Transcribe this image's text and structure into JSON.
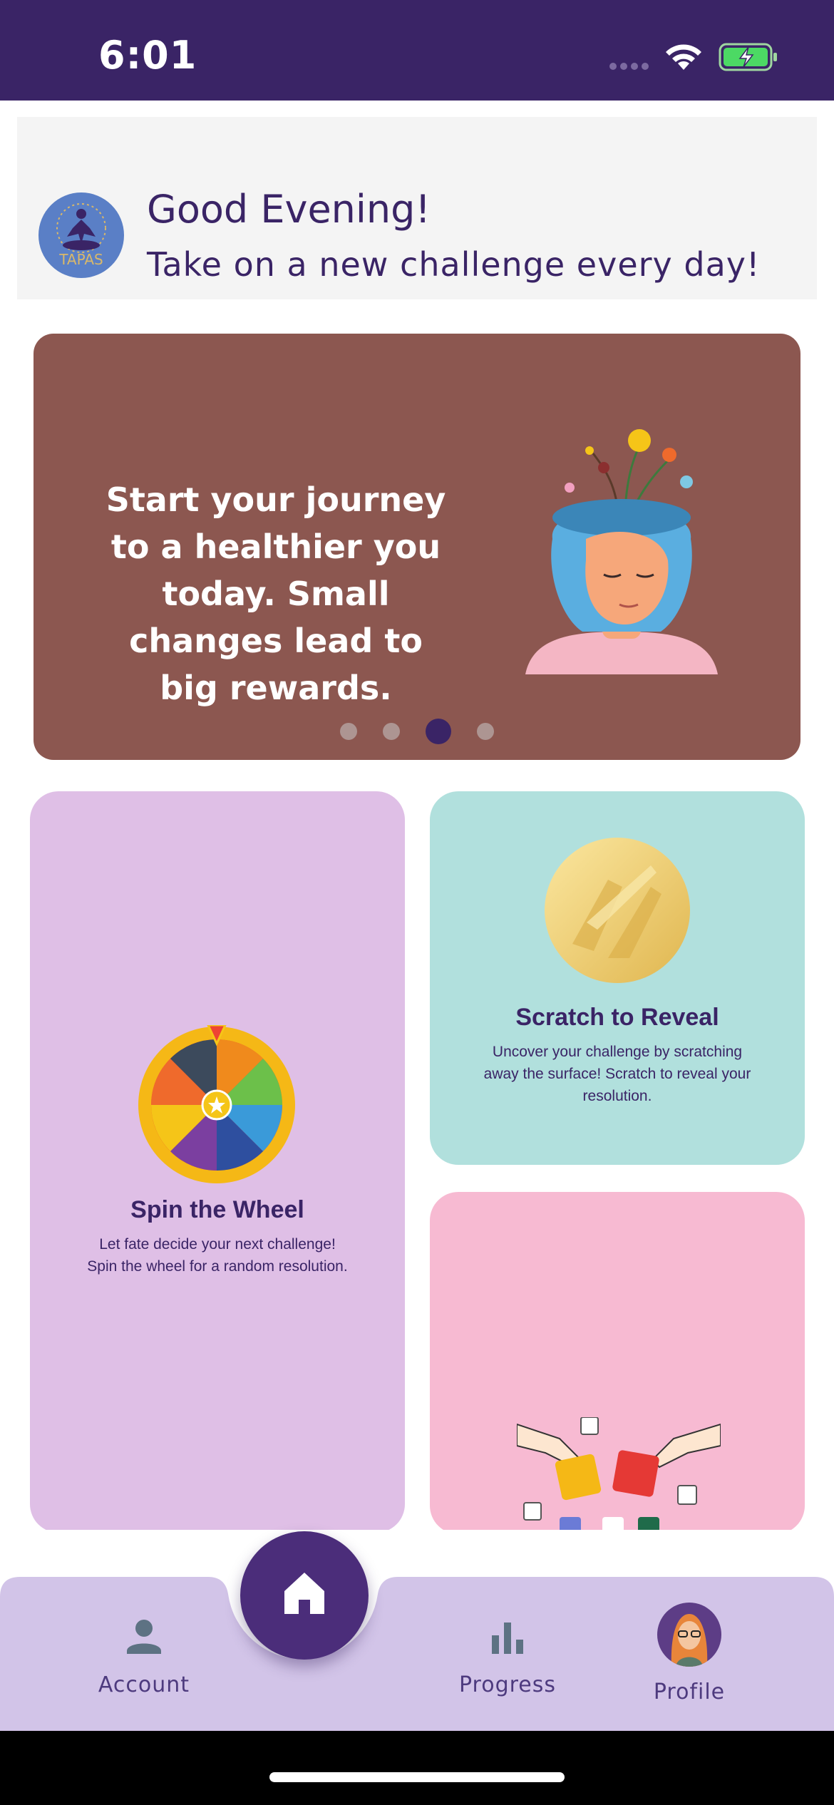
{
  "status_bar": {
    "time": "6:01"
  },
  "header": {
    "logo_text": "TAPAS",
    "greeting": "Good Evening!",
    "subtitle": "Take on a new challenge every day!"
  },
  "carousel": {
    "text": "Start your journey to a healthier you today. Small changes lead to big rewards.",
    "page_count": 4,
    "active_index": 2,
    "background": "#8c5750"
  },
  "cards": {
    "spin": {
      "title": "Spin the Wheel",
      "description": "Let fate decide your next challenge! Spin the wheel for a random resolution.",
      "icon": "wheel-icon",
      "background": "#dfbfe6"
    },
    "scratch": {
      "title": "Scratch to Reveal",
      "description": "Uncover your challenge by scratching away the surface! Scratch to reveal your resolution.",
      "icon": "gold-coin-icon",
      "background": "#b1e0dd"
    },
    "puzzle": {
      "icon": "puzzle-icon",
      "background": "#f7bad2"
    }
  },
  "bottom_nav": {
    "account": "Account",
    "progress": "Progress",
    "profile": "Profile",
    "home_icon": "home-icon",
    "background": "#d2c4e8",
    "accent": "#4b2d7a"
  }
}
